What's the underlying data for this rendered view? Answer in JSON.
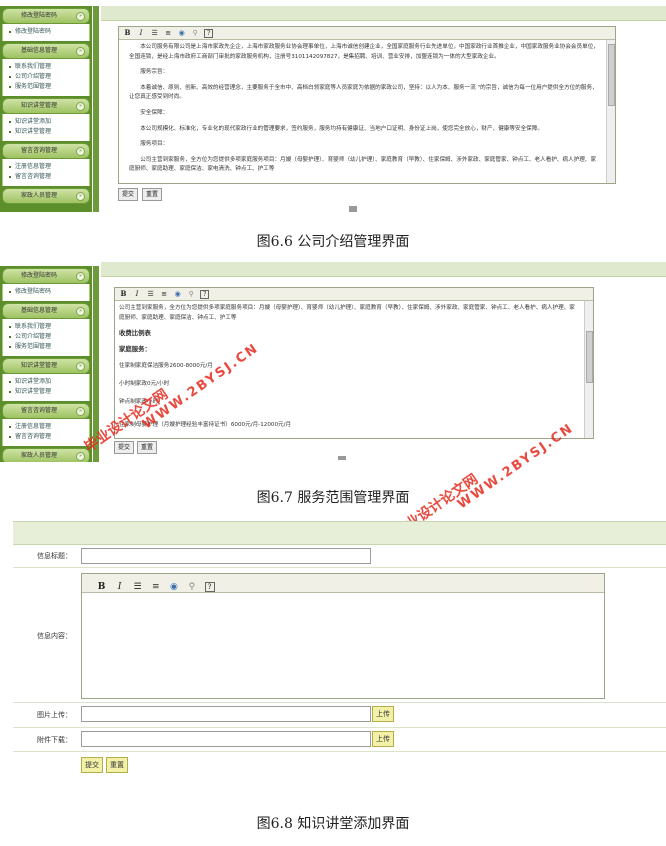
{
  "sidebar": {
    "groups": [
      {
        "title": "修改登陆密码",
        "items": [
          "修改登陆密码"
        ]
      },
      {
        "title": "基础信息管理",
        "items": [
          "联系我们管理",
          "公司介绍管理",
          "服务范围管理"
        ]
      },
      {
        "title": "知识讲堂管理",
        "items": [
          "知识讲堂添加",
          "知识讲堂管理"
        ]
      },
      {
        "title": "留言咨询管理",
        "items": [
          "注册信息管理",
          "留言咨询管理"
        ]
      },
      {
        "title": "家政人员管理",
        "items": []
      }
    ]
  },
  "editor": {
    "toolbar_icons": [
      "bold-icon",
      "italic-icon",
      "ordered-list-icon",
      "unordered-list-icon",
      "image-icon",
      "link-icon",
      "help-icon"
    ],
    "bold_glyph": "B",
    "italic_glyph": "I",
    "help_glyph": "?"
  },
  "figure1": {
    "paragraphs": [
      "本公司服务有限公司是上海市家政先企企，上海市家政服务业协会理事单位，上海市诚信创建企业，全国家庭服务行业先进单位，中国家政行业首推企业，中国家政服务业协会会员单位，全国连锁，是经上海市政府工商部门审批的家政服务机构，注册号3101142097827，是集招聘、培训、营业安排，加盟连锁为一体的大型家政企业。",
      "服务宗旨：",
      "本着诚信、原则、创新、高效的经营理念，主要服务于全市中、高档白领家庭等人员家庭为依据的家政公司，坚持：以人为本、服务一流 \"的宗旨，诚信为每一位用户提供全方位的服务，让您真正感受到时尚。",
      "安全保障：",
      "本公司规模化、标准化，专业化的现代家政行业的管理要求，签约服务，服务均持有健康证、当地户口证明、身份证上岗，使您完全放心，财产、健康等安全保障。",
      "服务项目：",
      "公司主营到家服务，全方位为您提供多项家庭服务项目：月嫂（母婴护理）、育婴师（幼儿护理）、家庭教育（早教）、住家保姆、涉外家政、家庭管家、钟点工、老人看护、病人护理、家庭厨师、家庭助理、家庭保洁、家电清洗、钟点工、护工等"
    ],
    "submit": "提交",
    "reset": "重置",
    "caption": "图6.6  公司介绍管理界面"
  },
  "figure2": {
    "paragraphs": [
      "公司主营到家服务，全方位为您提供多项家庭服务项目：月嫂（母婴护理）、育婴师（幼儿护理）、家庭教育（早教）、住家保姆、涉外家政、家庭管家、钟点工、老人看护、病人护理、家庭厨师、家庭助理、家庭保洁、钟点工、护工等",
      "收费比例表",
      "家庭服务：",
      "住家制家庭保洁服务2600-8000元/月",
      "小时制家政0元/小时",
      "钟点制家政小时",
      "住家制母婴护理（月嫂护理经验丰富持证书）6000元/月-12000元/月"
    ],
    "submit": "提交",
    "reset": "重置",
    "caption": "图6.7  服务范围管理界面"
  },
  "watermarks": {
    "cn": "毕业设计论文网",
    "url": "WWW.2BYSJ.CN"
  },
  "figure3": {
    "fields": {
      "title_label": "信息标题：",
      "content_label": "信息内容：",
      "image_label": "图片上传：",
      "attachment_label": "附件下载：",
      "upload": "上传"
    },
    "submit": "提交",
    "reset": "重置",
    "caption": "图6.8  知识讲堂添加界面"
  }
}
